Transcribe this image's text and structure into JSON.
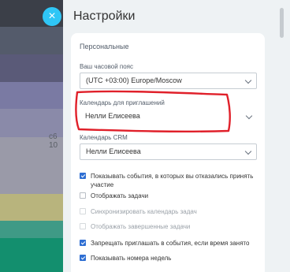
{
  "background": {
    "bands": [
      {
        "color": "#3b3f48"
      },
      {
        "color": "#545b6b"
      },
      {
        "color": "#5a5a78"
      },
      {
        "color": "#7a7aa3"
      },
      {
        "color": "#8a8aa9"
      },
      {
        "color": "#9a9aa8"
      },
      {
        "color": "#b8b47d"
      },
      {
        "color": "#3f9a86"
      },
      {
        "color": "#138f6e"
      }
    ],
    "time_text": "c6 10"
  },
  "close_button": {
    "icon": "close-icon",
    "glyph": "×"
  },
  "panel": {
    "title": "Настройки",
    "section_title": "Персональные",
    "timezone": {
      "label": "Ваш часовой пояс",
      "value": "(UTC +03:00) Europe/Moscow"
    },
    "invite_calendar": {
      "label": "Календарь для приглашений",
      "value": "Нелли Елисеева"
    },
    "crm_calendar": {
      "label": "Календарь CRM",
      "value": "Нелли Елисеева"
    },
    "options": [
      {
        "label": "Показывать события, в которых вы отказались принять участие",
        "checked": true,
        "disabled": false
      },
      {
        "label": "Отображать задачи",
        "checked": false,
        "disabled": false
      },
      {
        "label": "Синхронизировать календарь задач",
        "checked": false,
        "disabled": true
      },
      {
        "label": "Отображать завершенные задачи",
        "checked": false,
        "disabled": true
      },
      {
        "label": "Запрещать приглашать в события, если время занято",
        "checked": true,
        "disabled": false
      },
      {
        "label": "Показывать номера недель",
        "checked": true,
        "disabled": false
      }
    ]
  },
  "colors": {
    "accent": "#2fc6f6",
    "checkbox": "#2f6fd3",
    "highlight": "#e0202a"
  }
}
